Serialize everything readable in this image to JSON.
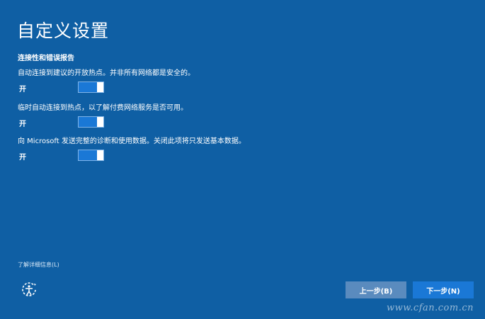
{
  "page": {
    "title": "自定义设置",
    "section_heading": "连接性和错误报告"
  },
  "settings": [
    {
      "description": "自动连接到建议的开放热点。并非所有网络都是安全的。",
      "state": "开",
      "on": true
    },
    {
      "description": "临时自动连接到热点，以了解付费网络服务是否可用。",
      "state": "开",
      "on": true
    },
    {
      "description": "向 Microsoft 发送完整的诊断和使用数据。关闭此项将只发送基本数据。",
      "state": "开",
      "on": true
    }
  ],
  "footer": {
    "learn_more": "了解详细信息(L)",
    "back_label": "上一步(B)",
    "next_label": "下一步(N)",
    "accessibility_icon": "ease-of-access-icon"
  },
  "watermark": "www.cfan.com.cn",
  "colors": {
    "background": "#0f5fa4",
    "toggle_on": "#1a78d6",
    "back_button": "#5a8bbe",
    "next_button": "#1a78d6"
  }
}
